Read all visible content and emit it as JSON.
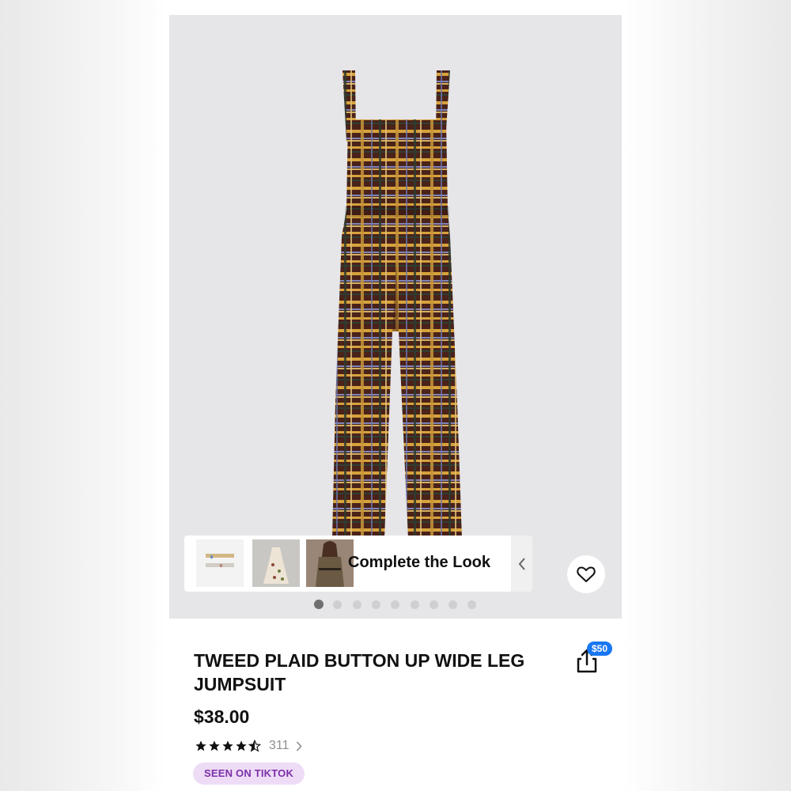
{
  "product": {
    "title": "TWEED PLAID BUTTON UP WIDE LEG JUMPSUIT",
    "price": "$38.00",
    "rating": 4.5,
    "review_count": "311",
    "tag": "SEEN ON TIKTOK",
    "share_badge": "$50",
    "image_icon": "plaid-jumpsuit-image"
  },
  "complete_the_look": {
    "label": "Complete the Look",
    "thumbs": [
      "earrings-thumbnail",
      "floral-dress-thumbnail",
      "model-outfit-thumbnail"
    ]
  },
  "gallery": {
    "total_images": 9,
    "active_index": 0
  },
  "colors": {
    "gallery_bg": "#e6e5e8",
    "badge": "#1877f2",
    "tag_bg": "#eedcf7",
    "tag_text": "#7b2fa8"
  }
}
